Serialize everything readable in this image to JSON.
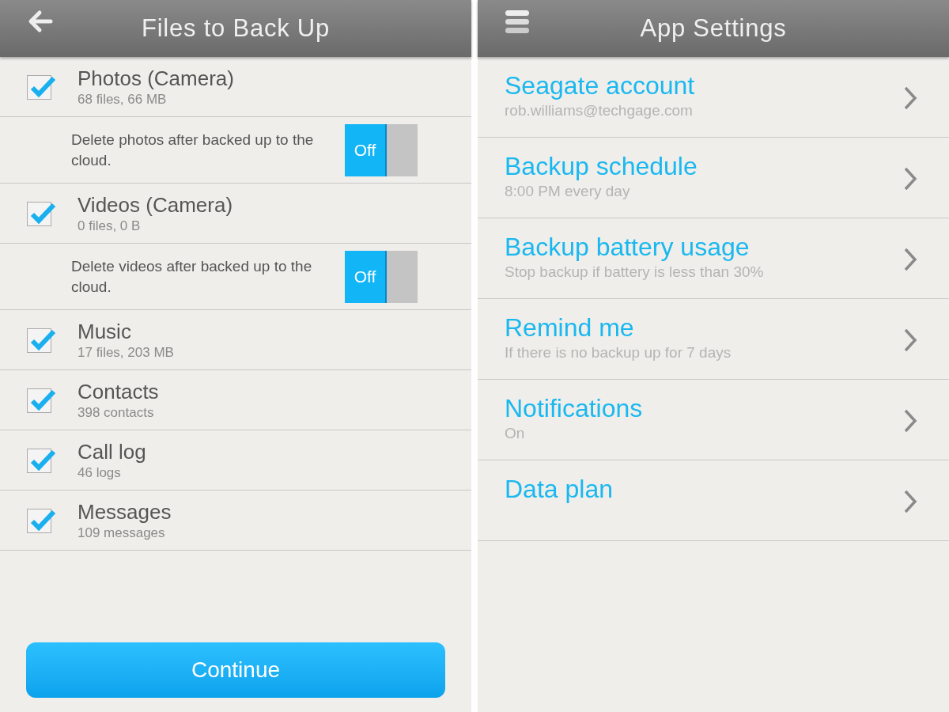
{
  "backup_screen": {
    "title": "Files to Back Up",
    "items": [
      {
        "kind": "category",
        "title": "Photos (Camera)",
        "subtitle": "68 files, 66 MB",
        "checked": true
      },
      {
        "kind": "toggle",
        "text": "Delete photos after backed up to the cloud.",
        "switch_label": "Off",
        "on": false
      },
      {
        "kind": "category",
        "title": "Videos (Camera)",
        "subtitle": "0 files, 0 B",
        "checked": true
      },
      {
        "kind": "toggle",
        "text": "Delete videos after backed up to the cloud.",
        "switch_label": "Off",
        "on": false
      },
      {
        "kind": "category",
        "title": "Music",
        "subtitle": "17 files, 203 MB",
        "checked": true
      },
      {
        "kind": "category",
        "title": "Contacts",
        "subtitle": "398 contacts",
        "checked": true
      },
      {
        "kind": "category",
        "title": "Call log",
        "subtitle": "46 logs",
        "checked": true
      },
      {
        "kind": "category",
        "title": "Messages",
        "subtitle": "109 messages",
        "checked": true
      }
    ],
    "continue_button": "Continue"
  },
  "settings_screen": {
    "title": "App Settings",
    "items": [
      {
        "title": "Seagate account",
        "subtitle": "rob.williams@techgage.com"
      },
      {
        "title": "Backup schedule",
        "subtitle": "8:00 PM every day"
      },
      {
        "title": "Backup battery usage",
        "subtitle": "Stop backup if battery is less than 30%"
      },
      {
        "title": "Remind me",
        "subtitle": "If there is no backup up for 7 days"
      },
      {
        "title": "Notifications",
        "subtitle": "On"
      },
      {
        "title": "Data plan"
      }
    ]
  }
}
